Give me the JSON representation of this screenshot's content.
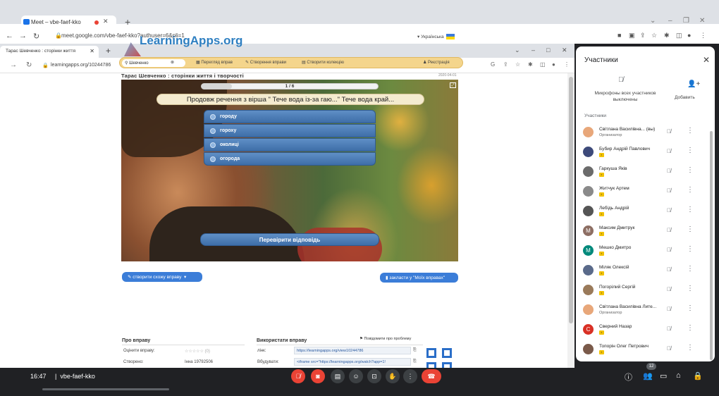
{
  "outer_browser": {
    "tab_title": "Meet – vbe-faef-kko",
    "url": "meet.google.com/vbe-faef-kko?authuser=6&pli=1"
  },
  "inner_browser": {
    "tab_title": "Тарас Шевченко : сторінки життя",
    "url": "learningapps.org/10244786"
  },
  "learningapps": {
    "logo": "LearningApps.org",
    "language": "Українська",
    "search_value": "Шевченко",
    "menu": [
      "Перегляд вправ",
      "Створення вправи",
      "Створити колекцію"
    ],
    "register": "Реєстрація",
    "app_title": "Тарас Шевченко : сторінки життя і творчості",
    "date": "2020-04-01",
    "progress_text": "1 / 6",
    "progress_fraction": 0.17,
    "question": "Продовж речення з вірша \" Тече вода із-за гаю...\" Тече вода край...",
    "options": [
      "городу",
      "гороху",
      "околиці",
      "огорода"
    ],
    "check_button": "Перевірити відповідь",
    "create_similar": "створити схожу вправу",
    "save_to_mine": "закласти у \"Моїх вправах\"",
    "about_heading": "Про вправу",
    "use_heading": "Використати вправу",
    "report": "Повідомити про проблему",
    "rate_label": "Оцінити вправу:",
    "rate_value": "☆☆☆☆☆ (0)",
    "created_label": "Створено:",
    "created_value": "Інна 19792506",
    "link_label": "лінк:",
    "link_value": "https://learningapps.org/view10244786",
    "embed_label": "Вбудувати:",
    "embed_value": "<iframe src=\"https://learningapps.org/watch?app=1!"
  },
  "participants_panel": {
    "title": "Участники",
    "mic_text": "Микрофоны всех участников выключены",
    "add_label": "Добавить",
    "section": "Участники",
    "people": [
      {
        "name": "Світлана Василівна... (вы)",
        "sub": "Организатор",
        "avatar_color": "#e8a77a",
        "letter": ""
      },
      {
        "name": "Бубир Андрій Павлович",
        "sub": "",
        "avatar_color": "#3d4a7a",
        "letter": ""
      },
      {
        "name": "Гаркуша Яків",
        "sub": "",
        "avatar_color": "#6b6b6b",
        "letter": ""
      },
      {
        "name": "Житчук Артем",
        "sub": "",
        "avatar_color": "#8a8a8a",
        "letter": ""
      },
      {
        "name": "Лебідь Андрій",
        "sub": "",
        "avatar_color": "#555",
        "letter": ""
      },
      {
        "name": "Максим Дмитрук",
        "sub": "",
        "avatar_color": "#8d6e63",
        "letter": "M"
      },
      {
        "name": "Мешко Дмитро",
        "sub": "",
        "avatar_color": "#00897b",
        "letter": "M"
      },
      {
        "name": "Міляк Олексій",
        "sub": "",
        "avatar_color": "#5a6a8a",
        "letter": ""
      },
      {
        "name": "Погорілий Сергій",
        "sub": "",
        "avatar_color": "#9a7a5a",
        "letter": ""
      },
      {
        "name": "Світлана Василівна Лите...",
        "sub": "Организатор",
        "avatar_color": "#e8a77a",
        "letter": ""
      },
      {
        "name": "Сверний Назар",
        "sub": "",
        "avatar_color": "#d93025",
        "letter": "C"
      },
      {
        "name": "Топорін Олег Петрович",
        "sub": "",
        "avatar_color": "#7a5a4a",
        "letter": ""
      }
    ]
  },
  "bottom_bar": {
    "time": "16:47",
    "meeting_code": "vbe-faef-kko",
    "participant_count": "12"
  }
}
